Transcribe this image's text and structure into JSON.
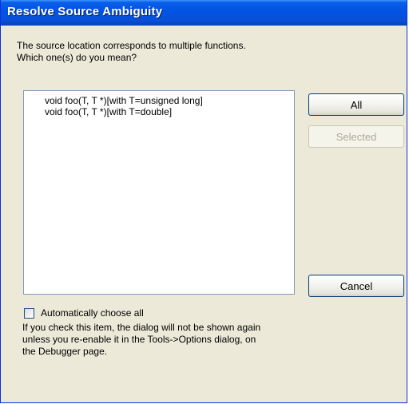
{
  "window": {
    "title": "Resolve Source Ambiguity"
  },
  "prompt": {
    "line1": "The source location corresponds to multiple functions.",
    "line2": "Which one(s) do you mean?"
  },
  "functions": [
    "void foo(T, T *)[with T=unsigned long]",
    "void foo(T, T *)[with T=double]"
  ],
  "buttons": {
    "all": "All",
    "selected": "Selected",
    "cancel": "Cancel"
  },
  "checkbox": {
    "label": "Automatically choose all",
    "checked": false
  },
  "note": {
    "line1": "If you check this item, the dialog will not be shown again",
    "line2": "unless you re-enable it in the Tools->Options dialog, on",
    "line3": "the Debugger page."
  },
  "colors": {
    "titlebar": "#0054e3",
    "dialog_background": "#ece9d8",
    "disabled_text": "#aca899"
  }
}
